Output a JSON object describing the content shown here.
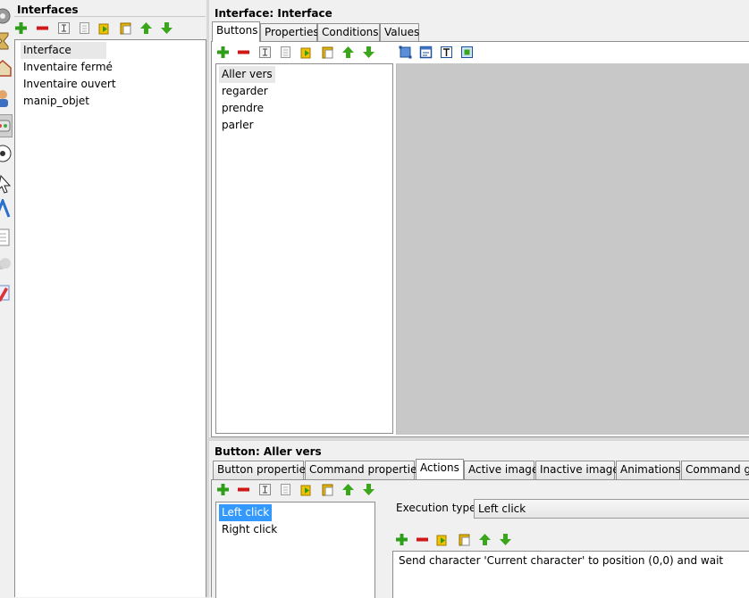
{
  "interfaces_panel": {
    "title": "Interfaces",
    "items": [
      "Interface",
      "Inventaire fermé",
      "Inventaire ouvert",
      "manip_objet"
    ]
  },
  "interface_panel": {
    "title": "Interface: Interface",
    "tabs": [
      "Buttons",
      "Properties",
      "Conditions",
      "Values"
    ],
    "buttons": [
      "Aller vers",
      "regarder",
      "prendre",
      "parler"
    ]
  },
  "button_panel": {
    "title": "Button: Aller vers",
    "tabs": [
      "Button properties",
      "Command properties",
      "Actions",
      "Active image",
      "Inactive image",
      "Animations",
      "Command gr"
    ],
    "events": [
      "Left click",
      "Right click"
    ],
    "execution_type_label": "Execution type",
    "execution_type_value": "Left click",
    "actions": [
      "Send character 'Current character' to position (0,0) and wait"
    ]
  },
  "colors": {
    "add": "#2e9e1a",
    "remove": "#d01818",
    "arrow": "#3aa61c",
    "selection": "#3399ff",
    "canvas": "#c8c8c8"
  },
  "icons": {
    "toolbar": [
      "add-icon",
      "remove-icon",
      "rename-icon",
      "properties-icon",
      "duplicate-icon",
      "paste-icon",
      "move-up-icon",
      "move-down-icon"
    ],
    "canvas_toolbar": [
      "select-rect-icon",
      "window-frame-icon",
      "text-box-icon",
      "fit-view-icon"
    ]
  }
}
